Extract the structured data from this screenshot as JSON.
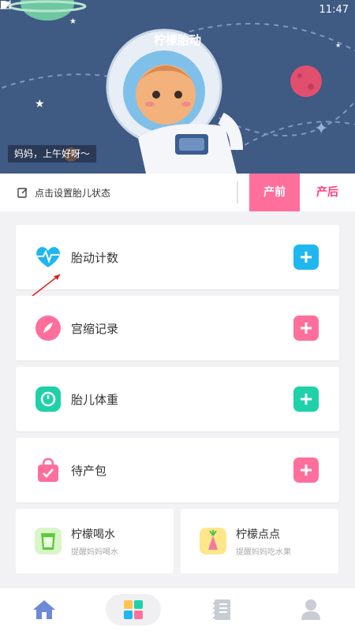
{
  "status_bar": {
    "time": "11:47"
  },
  "header": {
    "title": "柠檬胎动",
    "greeting": "妈妈，上午好呀～"
  },
  "status_row": {
    "set_status_label": "点击设置胎儿状态",
    "tabs": [
      {
        "label": "产前",
        "active": true
      },
      {
        "label": "产后",
        "active": false
      }
    ]
  },
  "cards": [
    {
      "label": "胎动计数",
      "icon": "heartbeat-icon",
      "color": "#1fb7f0"
    },
    {
      "label": "宫缩记录",
      "icon": "contraction-icon",
      "color": "#ff6f9c"
    },
    {
      "label": "胎儿体重",
      "icon": "scale-icon",
      "color": "#1fd1a8"
    },
    {
      "label": "待产包",
      "icon": "bag-icon",
      "color": "#ff6f9c"
    }
  ],
  "half_cards": [
    {
      "title": "柠檬喝水",
      "subtitle": "提醒妈妈喝水",
      "icon": "cup-icon"
    },
    {
      "title": "柠檬点点",
      "subtitle": "提醒妈妈吃水果",
      "icon": "fruit-icon"
    }
  ],
  "bottom_nav": [
    {
      "name": "home",
      "icon": "home-icon"
    },
    {
      "name": "apps",
      "icon": "grid-icon",
      "active": true
    },
    {
      "name": "records",
      "icon": "notebook-icon"
    },
    {
      "name": "profile",
      "icon": "user-icon"
    }
  ],
  "colors": {
    "hero_bg": "#3f5a83",
    "accent_pink": "#ff6f9c",
    "accent_blue": "#1fb7f0",
    "accent_green": "#1fd1a8"
  }
}
